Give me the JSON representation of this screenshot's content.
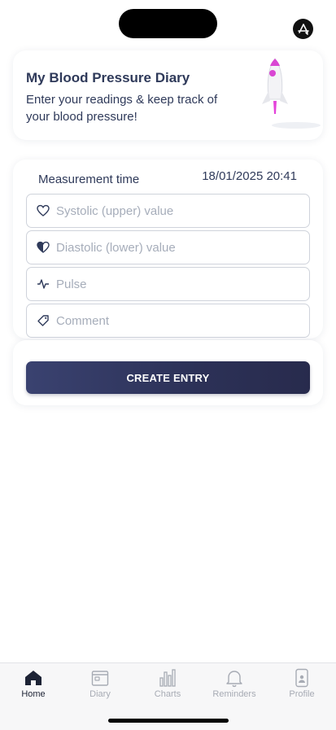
{
  "intro": {
    "title": "My Blood Pressure Diary",
    "subtitle": "Enter your readings & keep track of your blood pressure!"
  },
  "form": {
    "measurement_label": "Measurement time",
    "measurement_value": "18/01/2025 20:41",
    "fields": [
      {
        "icon": "heart-outline-icon",
        "placeholder": "Systolic (upper) value"
      },
      {
        "icon": "half-heart-icon",
        "placeholder": "Diastolic (lower) value"
      },
      {
        "icon": "pulse-icon",
        "placeholder": "Pulse"
      },
      {
        "icon": "tag-icon",
        "placeholder": "Comment"
      }
    ],
    "create_button": "CREATE ENTRY"
  },
  "tabs": [
    {
      "label": "Home",
      "icon": "house-icon",
      "active": true
    },
    {
      "label": "Diary",
      "icon": "calendar-icon",
      "active": false
    },
    {
      "label": "Charts",
      "icon": "bar-chart-icon",
      "active": false
    },
    {
      "label": "Reminders",
      "icon": "bell-icon",
      "active": false
    },
    {
      "label": "Profile",
      "icon": "phone-person-icon",
      "active": false
    }
  ],
  "colors": {
    "accent": "#2c3157",
    "text": "#2f3a5a",
    "placeholder": "#a6adba",
    "tab_inactive": "#a7abb4"
  }
}
